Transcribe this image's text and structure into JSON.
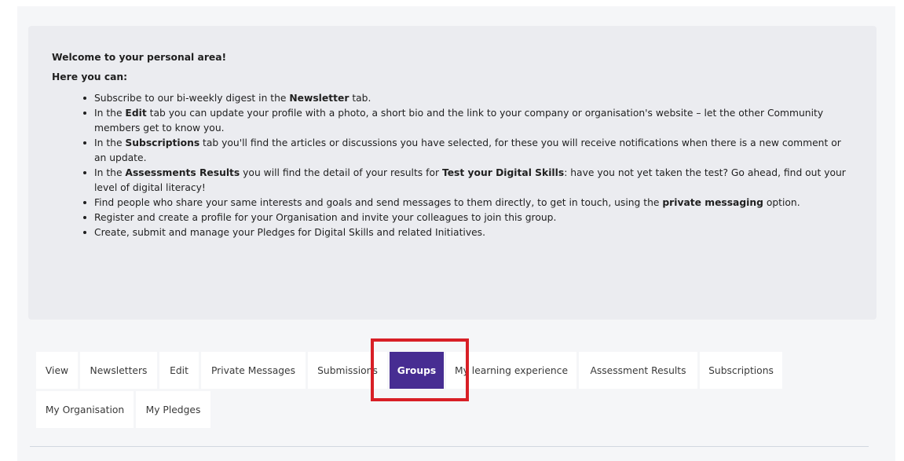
{
  "intro": {
    "welcome": "Welcome to your personal area!",
    "here_you_can": "Here you can:",
    "bullets": [
      {
        "parts": [
          {
            "t": "Subscribe to our bi-weekly digest in the "
          },
          {
            "b": "Newsletter"
          },
          {
            "t": " tab."
          }
        ]
      },
      {
        "parts": [
          {
            "t": "In the "
          },
          {
            "b": "Edit"
          },
          {
            "t": " tab you can update your profile with a photo, a short bio and the link to your company or organisation's website – let the other Community members get to know you."
          }
        ]
      },
      {
        "parts": [
          {
            "t": "In the "
          },
          {
            "b": "Subscriptions"
          },
          {
            "t": " tab you'll find the articles or discussions you have selected, for these you will receive notifications when there is a new comment or an update."
          }
        ]
      },
      {
        "parts": [
          {
            "t": "In the "
          },
          {
            "b": "Assessments Results"
          },
          {
            "t": " you will find the detail of your results for "
          },
          {
            "b": "Test your Digital Skills"
          },
          {
            "t": ": have you not yet taken the test? Go ahead, find out your level of digital literacy!"
          }
        ]
      },
      {
        "parts": [
          {
            "t": "Find people who share your same interests and goals and send messages to them directly, to get in touch, using the "
          },
          {
            "b": "private messaging"
          },
          {
            "t": " option."
          }
        ]
      },
      {
        "parts": [
          {
            "t": "Register and create a profile for your Organisation and invite your colleagues to join this group."
          }
        ]
      },
      {
        "parts": [
          {
            "t": "Create, submit and manage your Pledges for Digital Skills and related Initiatives."
          }
        ]
      }
    ]
  },
  "tabs": {
    "row1": [
      {
        "label": "View",
        "name": "tab-view"
      },
      {
        "label": "Newsletters",
        "name": "tab-newsletters"
      },
      {
        "label": "Edit",
        "name": "tab-edit"
      },
      {
        "label": "Private Messages",
        "name": "tab-private-messages"
      },
      {
        "label": "Submissions",
        "name": "tab-submissions"
      },
      {
        "label": "Groups",
        "name": "tab-groups",
        "active": true
      },
      {
        "label": "My learning experience",
        "name": "tab-my-learning-experience"
      },
      {
        "label": "Assessment Results",
        "name": "tab-assessment-results"
      },
      {
        "label": "Subscriptions",
        "name": "tab-subscriptions"
      }
    ],
    "row2": [
      {
        "label": "My Organisation",
        "name": "tab-my-organisation"
      },
      {
        "label": "My Pledges",
        "name": "tab-my-pledges"
      }
    ]
  },
  "colors": {
    "active_tab": "#472d92",
    "highlight": "#d81f26",
    "info_background": "#ebecf0"
  }
}
